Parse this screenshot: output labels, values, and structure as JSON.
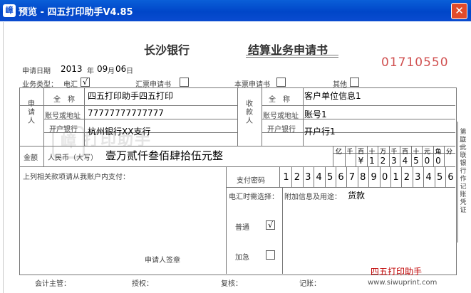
{
  "window": {
    "title": "预览 - 四五打印助手V4.85",
    "close": "✕",
    "icon": "嶂"
  },
  "form": {
    "bank": "长沙银行",
    "form_title": "结算业务申请书",
    "serial": "01710550",
    "date_label": "申请日期",
    "date_year": "2013",
    "date_month": "09",
    "date_day": "06",
    "year_unit": "年",
    "month_unit": "月",
    "day_unit": "日",
    "biz_type_label": "业务类型：",
    "remit_label": "电汇",
    "draft_label": "汇票申请书",
    "cashier_label": "本票申请书",
    "other_label": "其他",
    "checked_mark": "√",
    "applicant_side": "申请人",
    "payee_side": "收款人",
    "name_label": "全　称",
    "account_label": "账号或地址",
    "bank_label": "开户银行",
    "applicant_name": "四五打印助手四五打印",
    "applicant_account": "77777777777777",
    "applicant_bank": "杭州银行XX支行",
    "payee_name": "客户单位信息1",
    "payee_account": "账号1",
    "payee_bank": "开户行1",
    "amount_label": "金额",
    "amount_currency_label": "人民币（大写）",
    "amount_words": "壹万贰仟叁佰肆拾伍元整",
    "digit_headers": [
      "亿",
      "千",
      "百",
      "十",
      "万",
      "千",
      "百",
      "十",
      "元",
      "角",
      "分"
    ],
    "amount_digits": [
      "",
      "",
      "¥",
      "1",
      "2",
      "3",
      "4",
      "5",
      "0",
      "0",
      ""
    ],
    "note_label": "上列相关款项请从我账户内支付：",
    "pay_pw_label": "支付密码",
    "pay_pw_digits": [
      "1",
      "2",
      "3",
      "4",
      "5",
      "6",
      "7",
      "8",
      "9",
      "0",
      "1",
      "2",
      "3",
      "4",
      "5",
      "6"
    ],
    "time_label": "电汇时需选择：",
    "extra_label": "附加信息及用途：",
    "extra_value": "货款",
    "normal_label": "普通",
    "urgent_label": "加急",
    "signature_label": "申请人签章",
    "accountant_label": "会计主管：",
    "authorize_label": "授权：",
    "review_label": "复核：",
    "record_label": "记账：",
    "stub_text": "第联此联银行作记账凭证",
    "stub_num": "二"
  },
  "watermark": "打印助手",
  "brand": {
    "name": "四五打印助手",
    "url": "www.siwuprint.com"
  }
}
